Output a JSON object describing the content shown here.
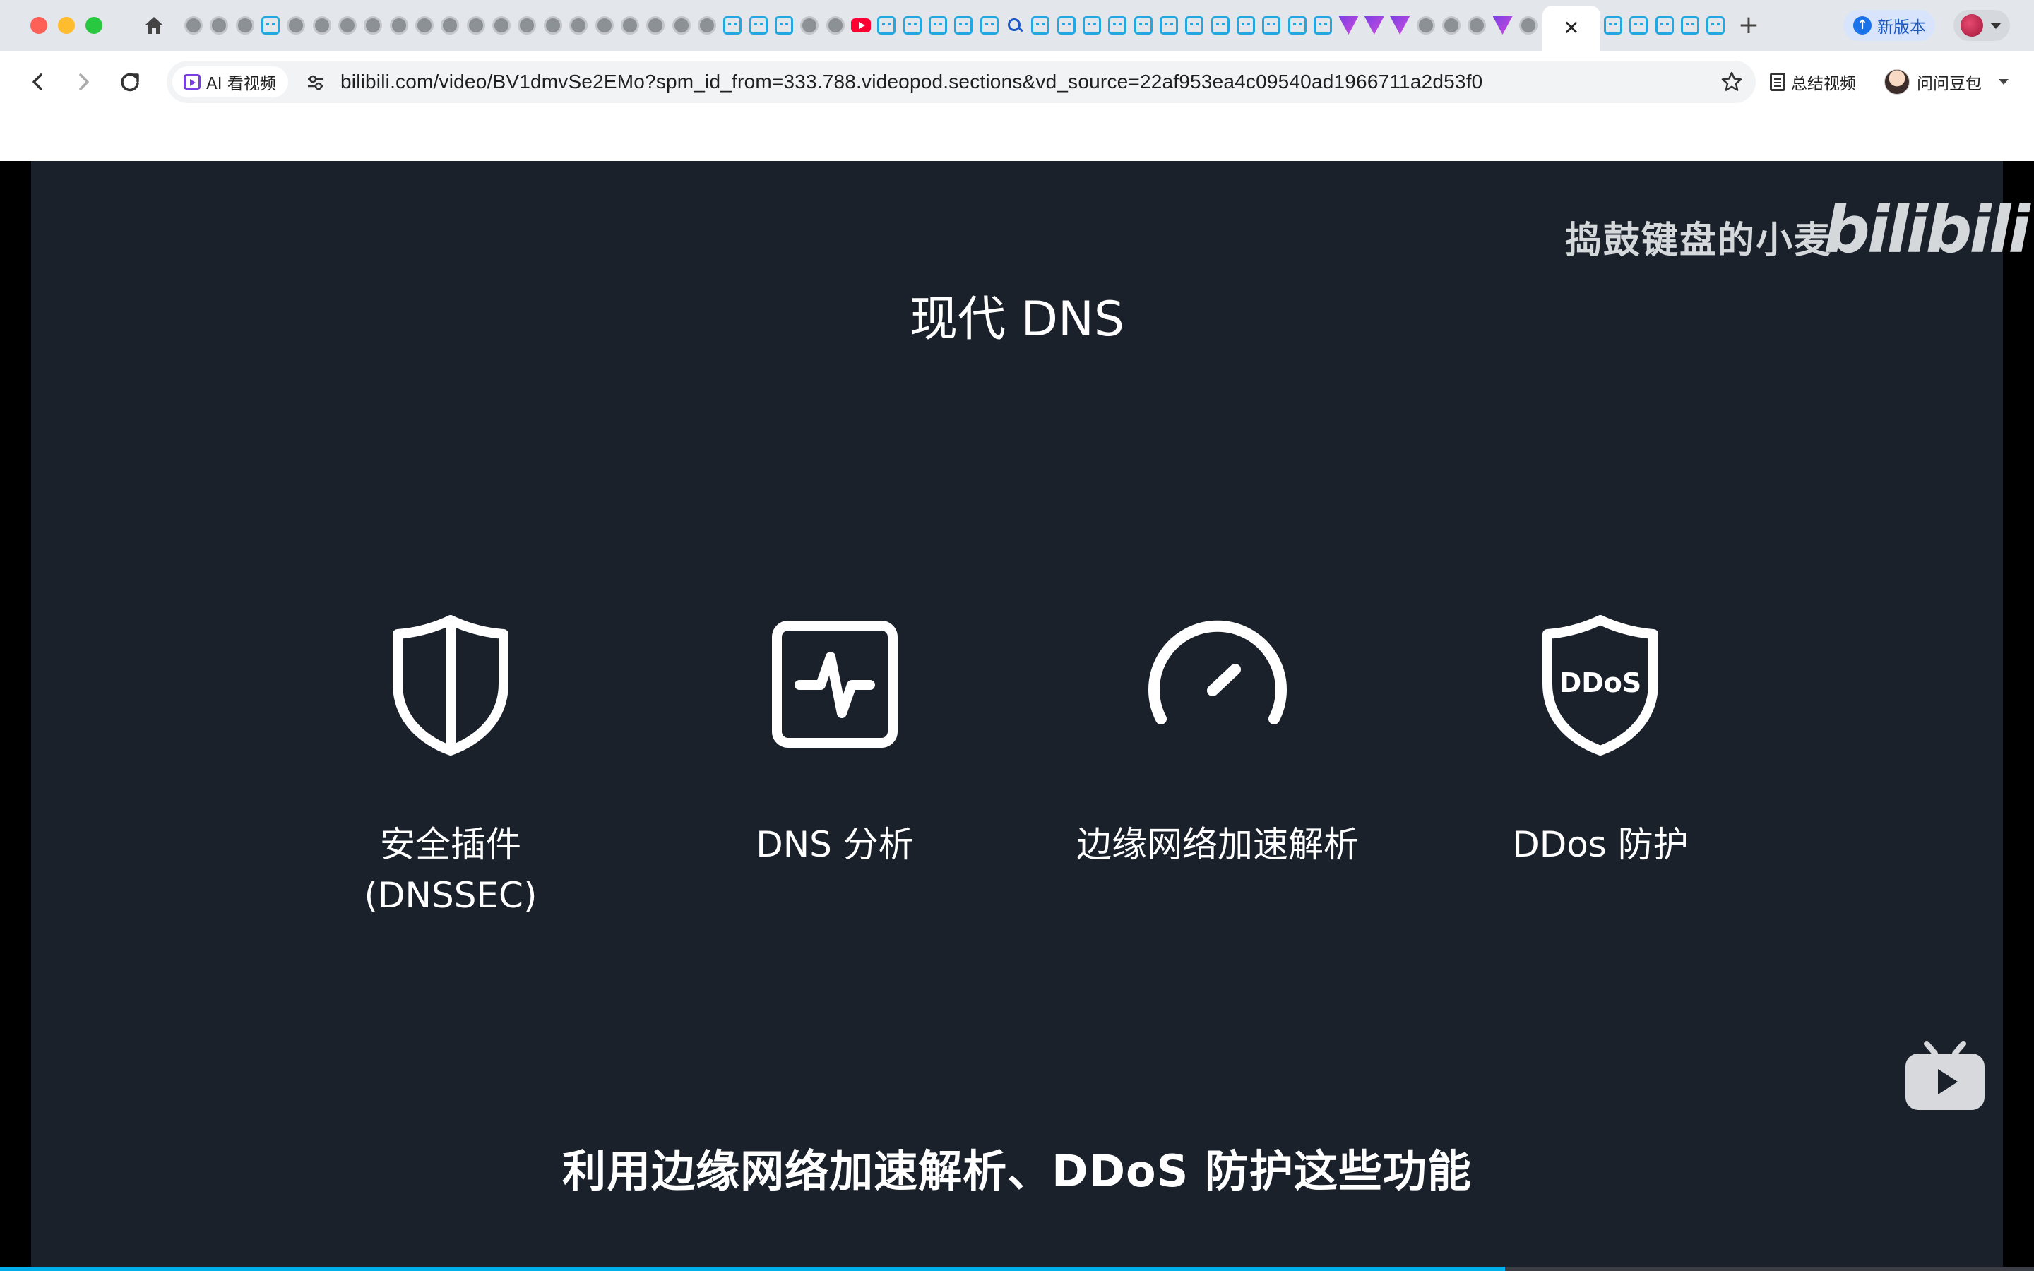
{
  "browser": {
    "tabs": {
      "favicons": [
        "globe",
        "globe",
        "globe",
        "bili",
        "globe",
        "globe",
        "globe",
        "globe",
        "globe",
        "globe",
        "globe",
        "globe",
        "globe",
        "globe",
        "globe",
        "globe",
        "globe",
        "globe",
        "globe",
        "globe",
        "globe",
        "bili",
        "bili",
        "bili",
        "globe",
        "globe",
        "yt",
        "bili",
        "bili",
        "bili",
        "bili",
        "bili",
        "search",
        "bili",
        "bili",
        "bili",
        "bili",
        "bili",
        "bili",
        "bili",
        "bili",
        "bili",
        "bili",
        "bili",
        "bili",
        "vee",
        "vee",
        "vee",
        "globe",
        "globe",
        "globe",
        "vee",
        "globe",
        "pd"
      ],
      "active_close": "✕",
      "favicons_right": [
        "bili",
        "bili",
        "bili",
        "bili",
        "bili"
      ]
    },
    "new_tab": "+",
    "update_label": "新版本",
    "toolbar": {
      "ai_chip_label": "AI 看视频",
      "url": "bilibili.com/video/BV1dmvSe2EMo?spm_id_from=333.788.videopod.sections&vd_source=22af953ea4c09540ad1966711a2d53f0",
      "summary_label": "总结视频",
      "doubao_label": "问问豆包"
    }
  },
  "video": {
    "uploader_watermark": "捣鼓键盘的小麦",
    "logo_watermark": "bilibili",
    "slide_title": "现代 DNS",
    "features": [
      {
        "icon": "shield-icon",
        "label_line1": "安全插件",
        "label_line2": "(DNSSEC)"
      },
      {
        "icon": "pulse-icon",
        "label_line1": "DNS 分析",
        "label_line2": ""
      },
      {
        "icon": "speedometer-icon",
        "label_line1": "边缘网络加速解析",
        "label_line2": ""
      },
      {
        "icon": "ddos-shield-icon",
        "label_line1": "DDos 防护",
        "label_line2": ""
      }
    ],
    "ddos_badge_text": "DDoS",
    "subtitle": "利用边缘网络加速解析、DDoS 防护这些功能",
    "progress": 0.74,
    "colors": {
      "slide_bg": "#1a212b",
      "accent": "#00aeec"
    }
  }
}
